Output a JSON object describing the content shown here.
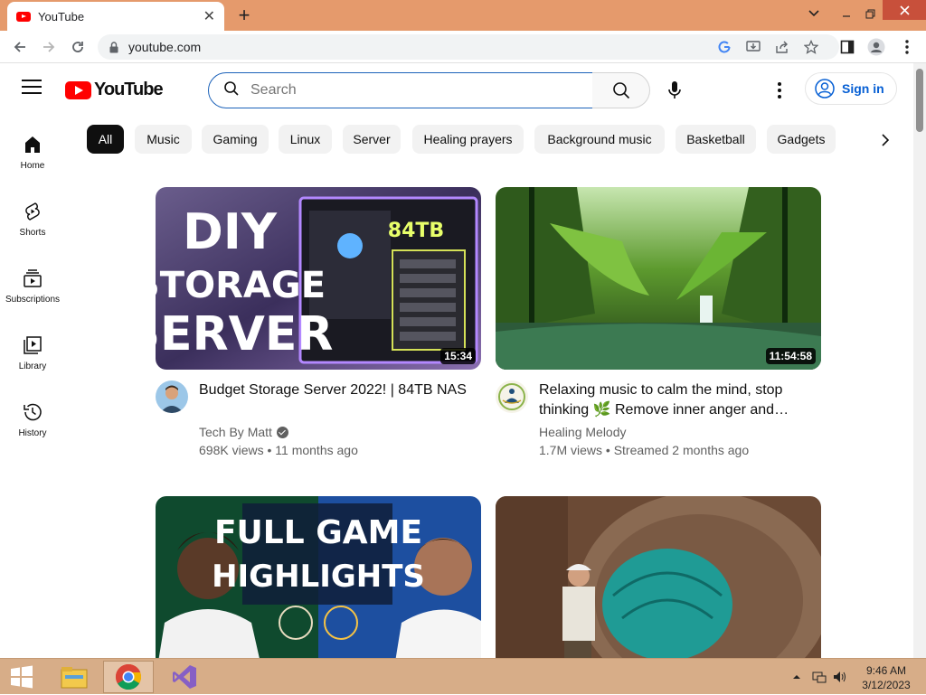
{
  "browser": {
    "tab_title": "YouTube",
    "url": "youtube.com"
  },
  "header": {
    "logo_text": "YouTube",
    "search_placeholder": "Search",
    "signin_label": "Sign in"
  },
  "guide": [
    {
      "label": "Home",
      "icon": "home-icon"
    },
    {
      "label": "Shorts",
      "icon": "shorts-icon"
    },
    {
      "label": "Subscriptions",
      "icon": "subscriptions-icon"
    },
    {
      "label": "Library",
      "icon": "library-icon"
    },
    {
      "label": "History",
      "icon": "history-icon"
    }
  ],
  "chips": [
    "All",
    "Music",
    "Gaming",
    "Linux",
    "Server",
    "Healing prayers",
    "Background music",
    "Basketball",
    "Gadgets"
  ],
  "videos": [
    {
      "title": "Budget Storage Server 2022! | 84TB NAS",
      "channel": "Tech By Matt",
      "verified": true,
      "meta": "698K views • 11 months ago",
      "duration": "15:34",
      "thumb_text_1": "DIY",
      "thumb_text_2": "STORAGE",
      "thumb_text_3": "SERVER",
      "thumb_badge": "84TB"
    },
    {
      "title": "Relaxing music to calm the mind, stop thinking 🌿 Remove inner anger and…",
      "channel": "Healing Melody",
      "verified": false,
      "meta": "1.7M views • Streamed 2 months ago",
      "duration": "11:54:58"
    },
    {
      "thumb_text_1": "FULL GAME",
      "thumb_text_2": "HIGHLIGHTS"
    },
    {}
  ],
  "taskbar": {
    "time": "9:46 AM",
    "date": "3/12/2023"
  },
  "colors": {
    "titlebar": "#e59a6c",
    "youtube_red": "#ff0000",
    "link_blue": "#065fd4",
    "taskbar": "#d7ad88"
  }
}
